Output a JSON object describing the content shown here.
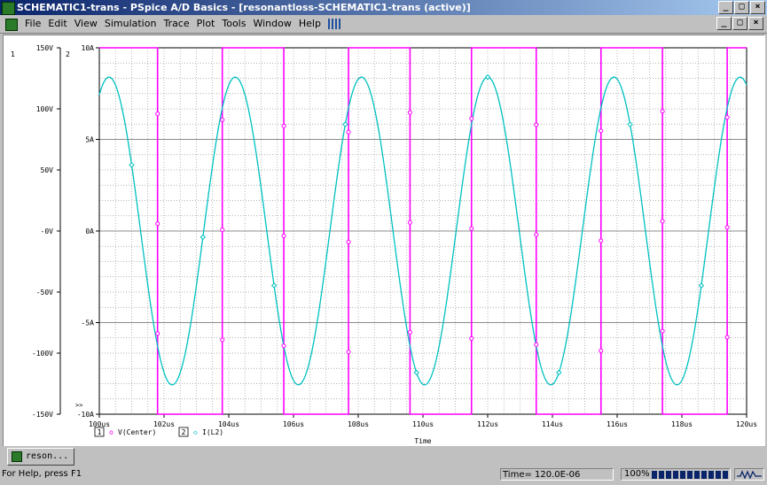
{
  "window": {
    "title": "SCHEMATIC1-trans - PSpice A/D Basics - [resonantloss-SCHEMATIC1-trans (active)]",
    "minimize": "_",
    "restore": "□",
    "close": "×"
  },
  "menu": {
    "items": [
      "File",
      "Edit",
      "View",
      "Simulation",
      "Trace",
      "Plot",
      "Tools",
      "Window",
      "Help"
    ]
  },
  "mdi": {
    "minimize": "_",
    "restore": "□",
    "close": "×"
  },
  "plot": {
    "axis1_id": "1",
    "axis2_id": "2",
    "xlabel": "Time",
    "legend": [
      {
        "id": "1",
        "name": "V(Center)",
        "color": "#ff00ff",
        "marker": "o"
      },
      {
        "id": "2",
        "name": "I(L2)",
        "color": "#00c0c0",
        "marker": "◇"
      }
    ],
    "marker_glyph": ">>"
  },
  "chart_data": {
    "type": "line",
    "xlabel": "Time",
    "x_ticks": [
      "100us",
      "102us",
      "104us",
      "106us",
      "108us",
      "110us",
      "112us",
      "114us",
      "116us",
      "118us",
      "120us"
    ],
    "xlim_us": [
      100,
      120
    ],
    "y_axis_left": {
      "ticks": [
        "150V",
        "100V",
        "50V",
        "-0V",
        "-50V",
        "-100V",
        "-150V"
      ],
      "ylim": [
        -150,
        150
      ],
      "unit": "V"
    },
    "y_axis_right": {
      "ticks": [
        "10A",
        "5A",
        "0A",
        "-5A",
        "-10A"
      ],
      "ylim": [
        -10,
        10
      ],
      "unit": "A"
    },
    "grid": true,
    "series": [
      {
        "name": "V(Center)",
        "axis": "1",
        "color": "#ff00ff",
        "shape": "square wave",
        "high": 150,
        "low": -150,
        "period_us": 3.9,
        "edges_us": [
          100.0,
          101.8,
          103.8,
          105.7,
          107.7,
          109.6,
          111.5,
          113.5,
          115.5,
          117.4,
          119.4
        ]
      },
      {
        "name": "I(L2)",
        "axis": "2",
        "color": "#00c0c0",
        "shape": "sinusoid",
        "amplitude": 8.4,
        "period_us": 3.9,
        "peaks_us": [
          104.2,
          108.1,
          112.0,
          115.9,
          119.8
        ],
        "troughs_us": [
          102.2,
          106.1,
          110.0,
          113.9,
          117.8
        ]
      }
    ]
  },
  "tab": {
    "label": "reson..."
  },
  "status": {
    "help": "For Help, press F1",
    "time": "Time= 120.0E-06",
    "zoom": "100%"
  }
}
